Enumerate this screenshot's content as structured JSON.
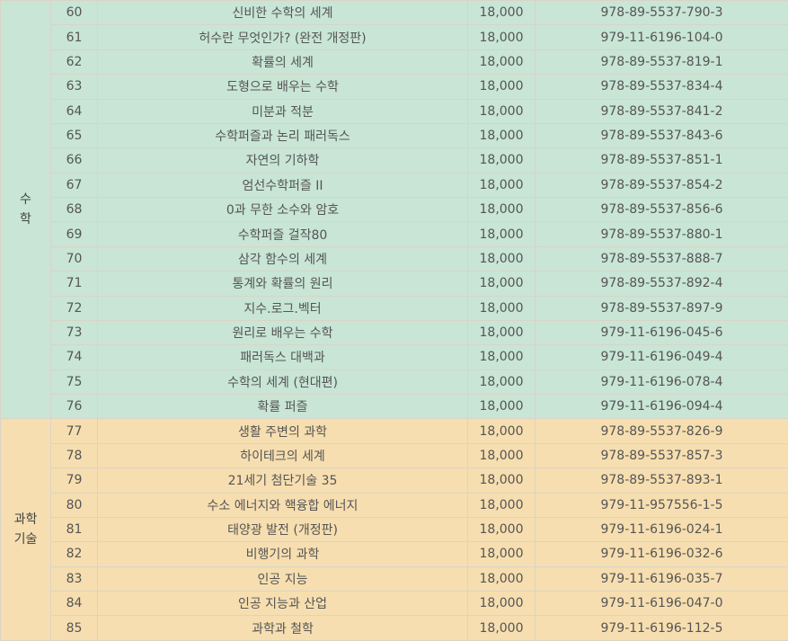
{
  "groups": [
    {
      "category": "수\n학",
      "rows": [
        {
          "no": "60",
          "title": "신비한 수학의 세계",
          "price": "18,000",
          "isbn": "978-89-5537-790-3"
        },
        {
          "no": "61",
          "title": "허수란 무엇인가? (완전 개정판)",
          "price": "18,000",
          "isbn": "979-11-6196-104-0"
        },
        {
          "no": "62",
          "title": "확률의 세계",
          "price": "18,000",
          "isbn": "978-89-5537-819-1"
        },
        {
          "no": "63",
          "title": "도형으로 배우는 수학",
          "price": "18,000",
          "isbn": "978-89-5537-834-4"
        },
        {
          "no": "64",
          "title": "미분과 적분",
          "price": "18,000",
          "isbn": "978-89-5537-841-2"
        },
        {
          "no": "65",
          "title": "수학퍼즐과 논리 패러독스",
          "price": "18,000",
          "isbn": "978-89-5537-843-6"
        },
        {
          "no": "66",
          "title": "자연의 기하학",
          "price": "18,000",
          "isbn": "978-89-5537-851-1"
        },
        {
          "no": "67",
          "title": "엄선수학퍼즐 II",
          "price": "18,000",
          "isbn": "978-89-5537-854-2"
        },
        {
          "no": "68",
          "title": "0과 무한 소수와 암호",
          "price": "18,000",
          "isbn": "978-89-5537-856-6"
        },
        {
          "no": "69",
          "title": "수학퍼즐 걸작80",
          "price": "18,000",
          "isbn": "978-89-5537-880-1"
        },
        {
          "no": "70",
          "title": "삼각 함수의 세계",
          "price": "18,000",
          "isbn": "978-89-5537-888-7"
        },
        {
          "no": "71",
          "title": "통계와 확률의 원리",
          "price": "18,000",
          "isbn": "978-89-5537-892-4"
        },
        {
          "no": "72",
          "title": "지수.로그.벡터",
          "price": "18,000",
          "isbn": "978-89-5537-897-9"
        },
        {
          "no": "73",
          "title": "원리로 배우는 수학",
          "price": "18,000",
          "isbn": "979-11-6196-045-6"
        },
        {
          "no": "74",
          "title": "패러독스 대백과",
          "price": "18,000",
          "isbn": "979-11-6196-049-4"
        },
        {
          "no": "75",
          "title": "수학의 세계 (현대편)",
          "price": "18,000",
          "isbn": "979-11-6196-078-4"
        },
        {
          "no": "76",
          "title": "확률 퍼즐",
          "price": "18,000",
          "isbn": "979-11-6196-094-4"
        }
      ]
    },
    {
      "category": "과학\n기술",
      "rows": [
        {
          "no": "77",
          "title": "생활 주변의 과학",
          "price": "18,000",
          "isbn": "978-89-5537-826-9"
        },
        {
          "no": "78",
          "title": "하이테크의 세계",
          "price": "18,000",
          "isbn": "978-89-5537-857-3"
        },
        {
          "no": "79",
          "title": "21세기 첨단기술 35",
          "price": "18,000",
          "isbn": "978-89-5537-893-1"
        },
        {
          "no": "80",
          "title": "수소 에너지와 핵융합 에너지",
          "price": "18,000",
          "isbn": "979-11-957556-1-5"
        },
        {
          "no": "81",
          "title": "태양광 발전 (개정판)",
          "price": "18,000",
          "isbn": "979-11-6196-024-1"
        },
        {
          "no": "82",
          "title": "비행기의 과학",
          "price": "18,000",
          "isbn": "979-11-6196-032-6"
        },
        {
          "no": "83",
          "title": "인공 지능",
          "price": "18,000",
          "isbn": "979-11-6196-035-7"
        },
        {
          "no": "84",
          "title": "인공 지능과 산업",
          "price": "18,000",
          "isbn": "979-11-6196-047-0"
        },
        {
          "no": "85",
          "title": "과학과 철학",
          "price": "18,000",
          "isbn": "979-11-6196-112-5"
        }
      ]
    }
  ]
}
